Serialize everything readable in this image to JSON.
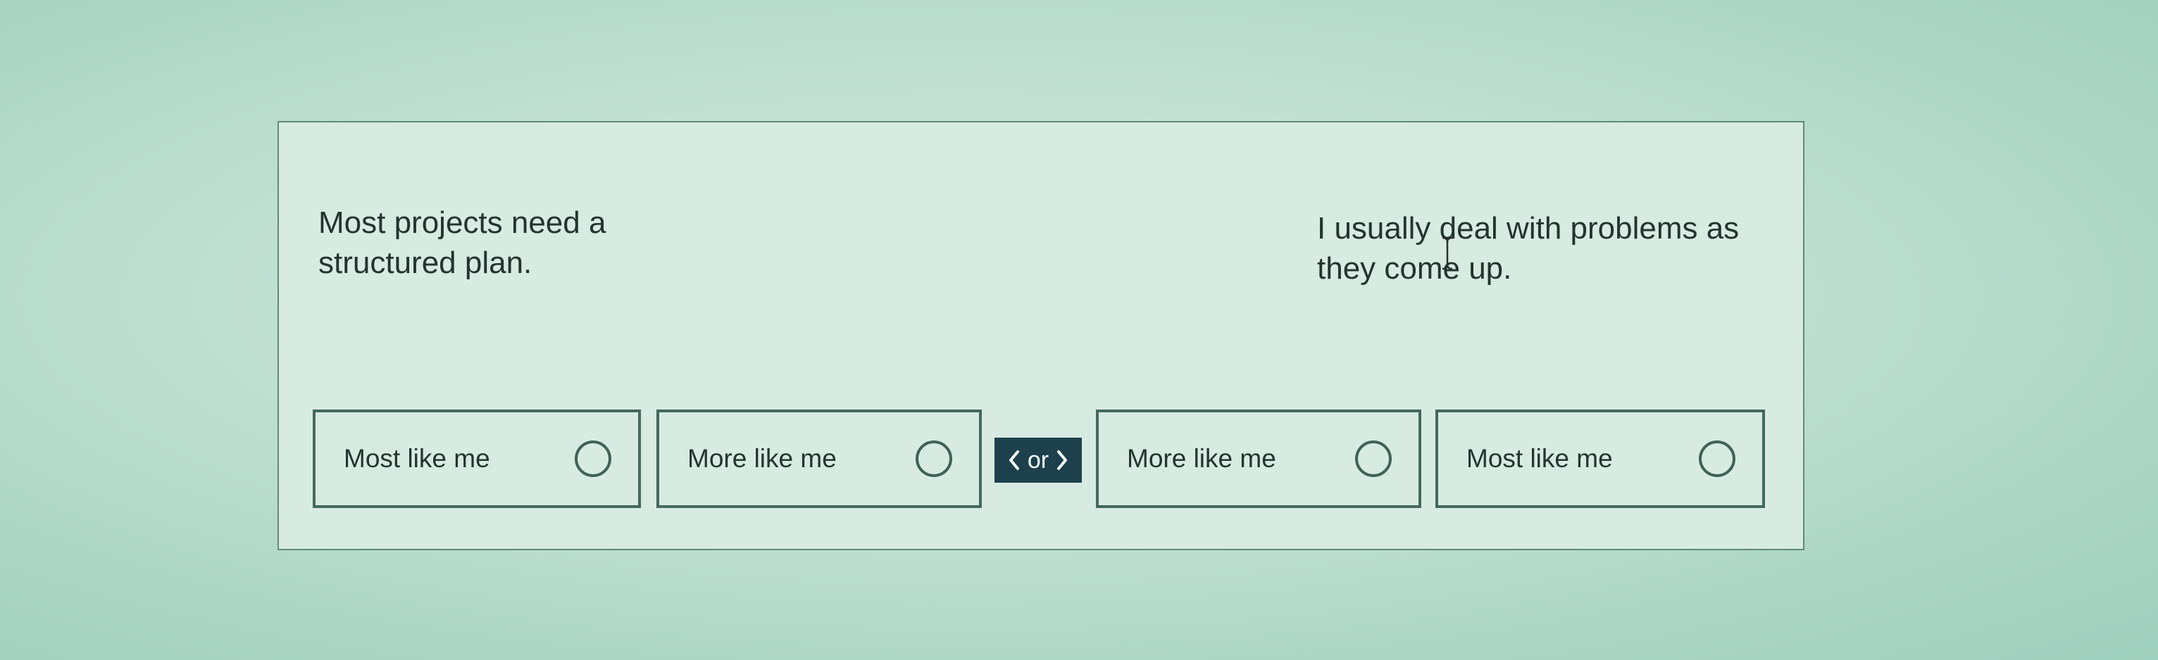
{
  "statements": {
    "left": "Most projects need a structured plan.",
    "right": "I usually deal with problems as they come up."
  },
  "options": {
    "left_most": "Most like me",
    "left_more": "More like me",
    "right_more": "More like me",
    "right_most": "Most like me"
  },
  "separator": {
    "label": "or",
    "left_icon": "chevron-left-icon",
    "right_icon": "chevron-right-icon"
  },
  "colors": {
    "background": "#bfdfd2",
    "card": "#d8ebe2",
    "option_border": "#44685d",
    "separator_bg": "#1c414d",
    "text": "#23342f"
  }
}
